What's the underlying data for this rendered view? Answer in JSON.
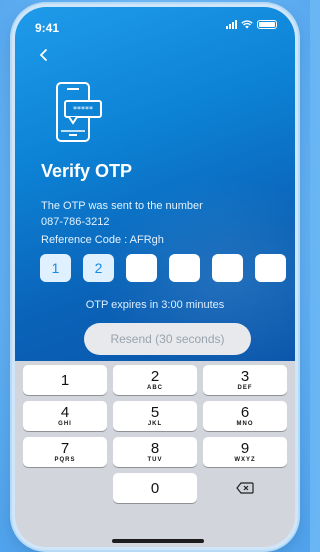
{
  "status": {
    "time": "9:41"
  },
  "header": {
    "back_icon": "chevron-left-icon",
    "illustration_icon": "phone-password-icon"
  },
  "title": "Verify OTP",
  "message_line1": "The OTP was sent to the number",
  "message_line2": "087-786-3212",
  "reference": "Reference Code : AFRgh",
  "otp": {
    "digits": [
      "1",
      "2",
      "",
      "",
      "",
      ""
    ]
  },
  "expires_text": "OTP expires in 3:00 minutes",
  "resend_label": "Resend (30 seconds)",
  "keypad": {
    "keys": [
      {
        "digit": "1",
        "letters": ""
      },
      {
        "digit": "2",
        "letters": "ABC"
      },
      {
        "digit": "3",
        "letters": "DEF"
      },
      {
        "digit": "4",
        "letters": "GHI"
      },
      {
        "digit": "5",
        "letters": "JKL"
      },
      {
        "digit": "6",
        "letters": "MNO"
      },
      {
        "digit": "7",
        "letters": "PQRS"
      },
      {
        "digit": "8",
        "letters": "TUV"
      },
      {
        "digit": "9",
        "letters": "WXYZ"
      },
      {
        "digit": "0",
        "letters": ""
      }
    ],
    "delete_icon": "backspace-icon"
  },
  "colors": {
    "primary": "#0d83d6",
    "background": "#6ab6f5",
    "keypad": "#d2d5db"
  }
}
